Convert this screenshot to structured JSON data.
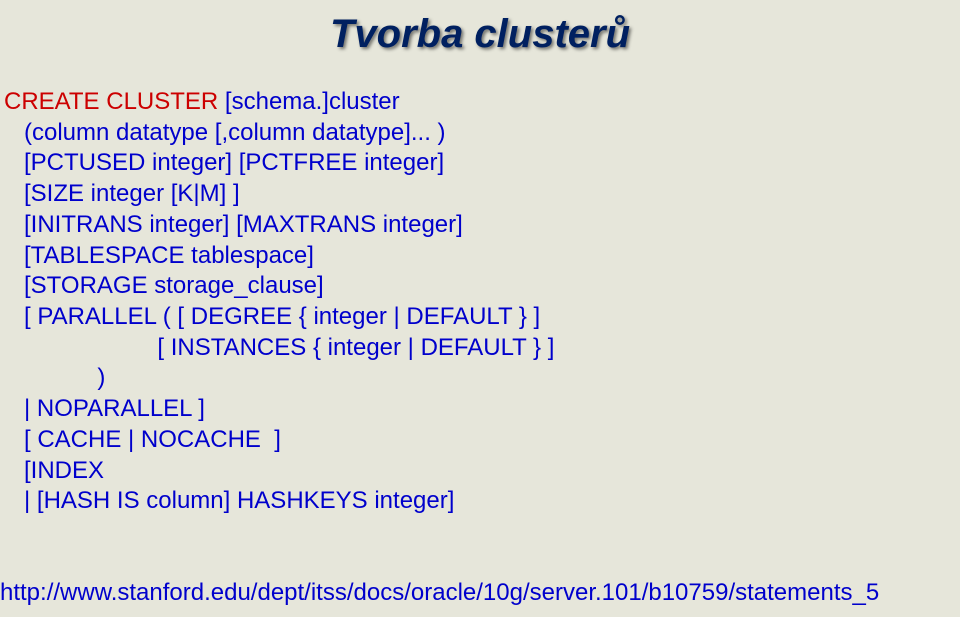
{
  "title": "Tvorba clusterů",
  "line1_a": "CREATE CLUSTER ",
  "line1_b": "[schema.]cluster",
  "line2": "   (column datatype [,column datatype]... )",
  "line3": "   [PCTUSED integer] [PCTFREE integer]",
  "line4": "   [SIZE integer [K|M] ]",
  "line5": "   [INITRANS integer] [MAXTRANS integer]",
  "line6": "   [TABLESPACE tablespace]",
  "line7": "   [STORAGE storage_clause]",
  "line8": "   [ PARALLEL ( [ DEGREE { integer | DEFAULT } ]",
  "line9": "                       [ INSTANCES { integer | DEFAULT } ]",
  "line10": "              )",
  "line11": "   | NOPARALLEL ]",
  "line12": "   [ CACHE | NOCACHE  ]",
  "line13": "   [INDEX",
  "line14": "   | [HASH IS column] HASHKEYS integer]",
  "link": "http://www.stanford.edu/dept/itss/docs/oracle/10g/server.101/b10759/statements_5"
}
